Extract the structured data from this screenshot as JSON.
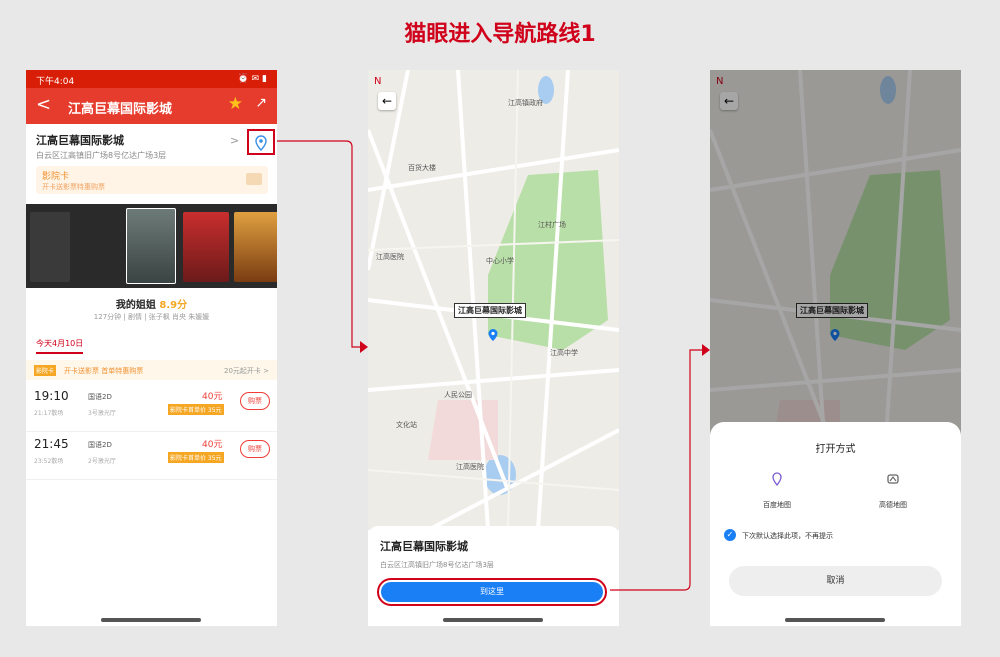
{
  "title": "猫眼进入导航路线1",
  "phone1": {
    "status": {
      "time": "下午4:04",
      "icons": "⏰ ✉ ▮"
    },
    "nav": {
      "back": "<",
      "title": "江高巨幕国际影城"
    },
    "cinema": {
      "name": "江高巨幕国际影城",
      "address": "白云区江高镇旧广场8号亿达广场3层",
      "chevron": ">"
    },
    "card": {
      "title": "影院卡",
      "sub": "开卡送影票特惠购票"
    },
    "movie": {
      "name": "我的姐姐",
      "score": "8.9分",
      "sub": "127分钟 | 剧情 | 张子枫 肖央 朱媛媛"
    },
    "date_tab": "今天4月10日",
    "promo": {
      "badge": "影院卡",
      "text": "开卡送影票 首单特惠购票",
      "right": "20元起开卡 >"
    },
    "showtimes": [
      {
        "time": "19:10",
        "end": "21:17散场",
        "lang": "国语2D",
        "hall": "3号激光厅",
        "price": "40元",
        "disc": "影院卡首单价 35元",
        "buy": "购票"
      },
      {
        "time": "21:45",
        "end": "23:52散场",
        "lang": "国语2D",
        "hall": "2号激光厅",
        "price": "40元",
        "disc": "影院卡首单价 35元",
        "buy": "购票"
      }
    ]
  },
  "phone2": {
    "back": "←",
    "compass": "N",
    "label": "江高巨幕国际影城",
    "name": "江高巨幕国际影城",
    "address": "白云区江高镇旧广场8号亿达广场3层",
    "go": "到这里",
    "places": [
      "江高镇政府",
      "江村广场",
      "百货大楼",
      "江高医院",
      "中心小学",
      "江高中学",
      "人民公园",
      "文化站",
      "江高医院"
    ]
  },
  "phone3": {
    "sheet_title": "打开方式",
    "apps": [
      "百度地图",
      "高德地图"
    ],
    "remember": "下次默认选择此项，不再提示",
    "cancel": "取消"
  },
  "colors": {
    "accent": "#d0021b",
    "map_blue": "#1a7ff5",
    "brand_red": "#e63c2d"
  }
}
